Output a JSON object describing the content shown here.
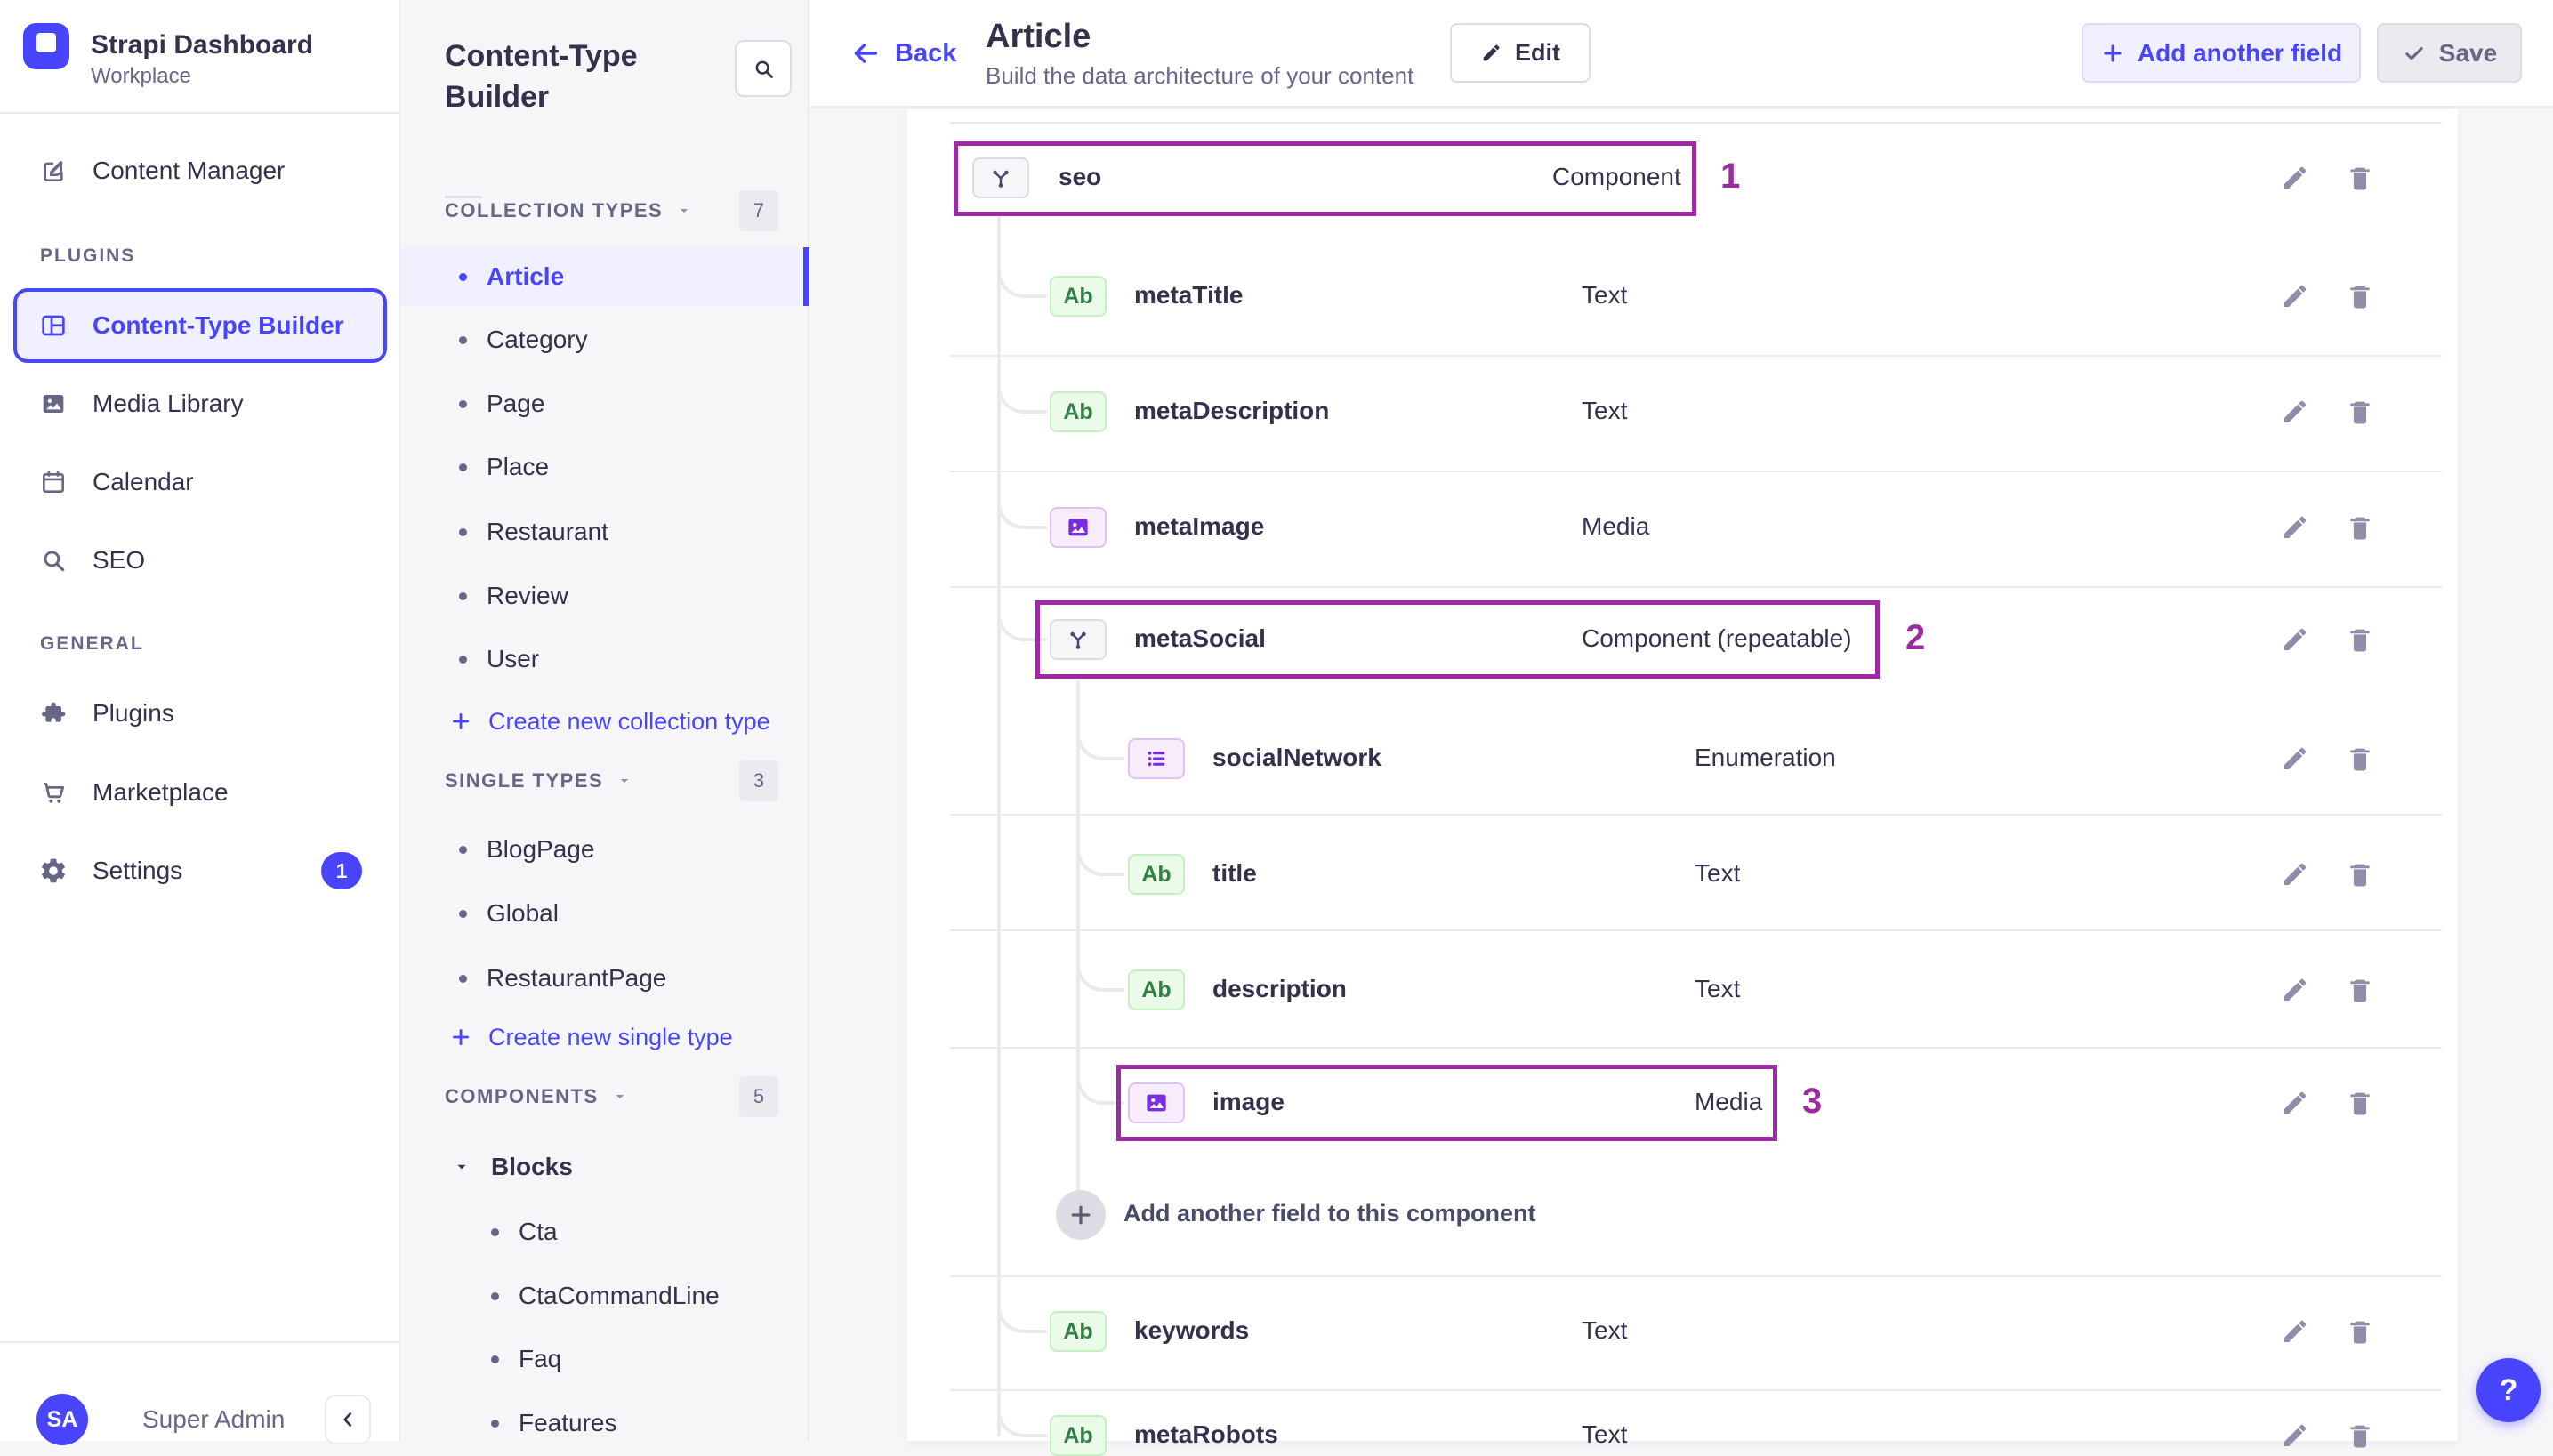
{
  "sidebar": {
    "brand": {
      "name": "Strapi Dashboard",
      "workspace": "Workplace"
    },
    "sections": [
      {
        "label": "",
        "items": [
          {
            "id": "content-manager",
            "icon": "feather",
            "label": "Content Manager"
          }
        ]
      },
      {
        "label": "PLUGINS",
        "items": [
          {
            "id": "content-type-builder",
            "icon": "layout",
            "label": "Content-Type Builder",
            "selected": true
          },
          {
            "id": "media-library",
            "icon": "picture",
            "label": "Media Library"
          },
          {
            "id": "calendar",
            "icon": "calendar",
            "label": "Calendar"
          },
          {
            "id": "seo",
            "icon": "magnifier",
            "label": "SEO"
          }
        ]
      },
      {
        "label": "GENERAL",
        "items": [
          {
            "id": "plugins",
            "icon": "puzzle",
            "label": "Plugins"
          },
          {
            "id": "marketplace",
            "icon": "cart",
            "label": "Marketplace"
          },
          {
            "id": "settings",
            "icon": "gear",
            "label": "Settings",
            "badge": "1"
          }
        ]
      }
    ],
    "user": {
      "initials": "SA",
      "name": "Super Admin"
    }
  },
  "builder": {
    "title": "Content-Type Builder",
    "groups": [
      {
        "label": "COLLECTION TYPES",
        "count": "7",
        "items": [
          {
            "label": "Article",
            "selected": true
          },
          {
            "label": "Category"
          },
          {
            "label": "Page"
          },
          {
            "label": "Place"
          },
          {
            "label": "Restaurant"
          },
          {
            "label": "Review"
          },
          {
            "label": "User"
          }
        ],
        "action": "Create new collection type"
      },
      {
        "label": "SINGLE TYPES",
        "count": "3",
        "items": [
          {
            "label": "BlogPage"
          },
          {
            "label": "Global"
          },
          {
            "label": "RestaurantPage"
          }
        ],
        "action": "Create new single type"
      },
      {
        "label": "COMPONENTS",
        "count": "5",
        "items": [
          {
            "label": "Blocks",
            "expanded": true,
            "children": [
              {
                "label": "Cta"
              },
              {
                "label": "CtaCommandLine"
              },
              {
                "label": "Faq"
              },
              {
                "label": "Features"
              }
            ]
          }
        ],
        "action": ""
      }
    ]
  },
  "header": {
    "back": "Back",
    "title": "Article",
    "subtitle": "Build the data architecture of your content",
    "edit": "Edit",
    "add_field": "Add another field",
    "save": "Save"
  },
  "fields": {
    "rows": [
      {
        "name": "seo",
        "type": "Component",
        "icon": "component",
        "level": 0,
        "marker": "1"
      },
      {
        "name": "metaTitle",
        "type": "Text",
        "icon": "text",
        "level": 1
      },
      {
        "name": "metaDescription",
        "type": "Text",
        "icon": "text",
        "level": 1
      },
      {
        "name": "metaImage",
        "type": "Media",
        "icon": "media",
        "level": 1
      },
      {
        "name": "metaSocial",
        "type": "Component (repeatable)",
        "icon": "component",
        "level": 1,
        "marker": "2"
      },
      {
        "name": "socialNetwork",
        "type": "Enumeration",
        "icon": "enumeration",
        "level": 2
      },
      {
        "name": "title",
        "type": "Text",
        "icon": "text",
        "level": 2
      },
      {
        "name": "description",
        "type": "Text",
        "icon": "text",
        "level": 2
      },
      {
        "name": "image",
        "type": "Media",
        "icon": "media",
        "level": 2,
        "marker": "3"
      },
      {
        "action": "Add another field to this component",
        "level": 2
      },
      {
        "name": "keywords",
        "type": "Text",
        "icon": "text",
        "level": 1
      },
      {
        "name": "metaRobots",
        "type": "Text",
        "icon": "text",
        "level": 1
      }
    ],
    "text_icon_label": "Ab"
  },
  "help": {
    "label": "?"
  },
  "colors": {
    "accent": "#4945ff",
    "accent_bg": "#f0f0ff",
    "highlight": "#9d2ba4",
    "text_dark": "#32324d",
    "text_gray": "#666687",
    "panel_bg": "#f6f6f9"
  }
}
